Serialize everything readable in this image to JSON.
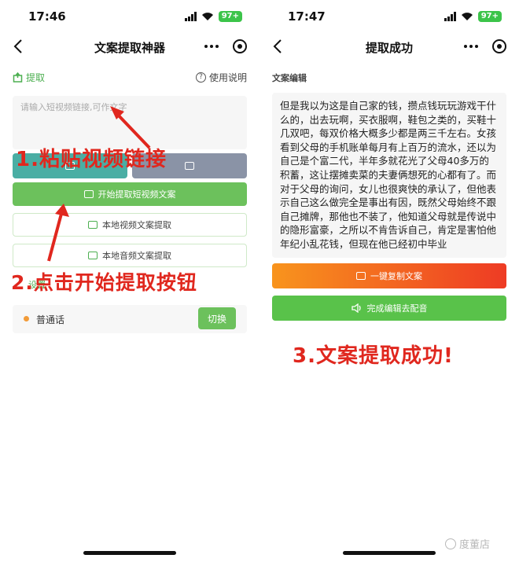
{
  "left": {
    "status": {
      "time": "17:46",
      "battery": "97+"
    },
    "nav": {
      "title": "文案提取神器"
    },
    "extract_tab": "提取",
    "help_label": "使用说明",
    "input_placeholder": "请输入短视频链接,可作文字",
    "start_button": "开始提取短视频文案",
    "local_video_button": "本地视频文案提取",
    "local_audio_button": "本地音频文案提取",
    "settings_label": "设置",
    "voice_name": "普通话",
    "switch_button": "切换"
  },
  "right": {
    "status": {
      "time": "17:47",
      "battery": "97+"
    },
    "nav": {
      "title": "提取成功"
    },
    "edit_label": "文案编辑",
    "extracted_text": "但是我以为这是自己家的钱，攒点钱玩玩游戏干什么的，出去玩啊，买衣服啊，鞋包之类的，买鞋十几双吧，每双价格大概多少都是两三千左右。女孩看到父母的手机账单每月有上百万的流水，还以为自己是个富二代，半年多就花光了父母40多万的积蓄，这让摆摊卖菜的夫妻俩想死的心都有了。而对于父母的询问，女儿也很爽快的承认了，但他表示自己这么做完全是事出有因，既然父母始终不跟自己摊牌，那他也不装了，他知道父母就是传说中的隐形富豪，之所以不肯告诉自己，肯定是害怕他年纪小乱花钱，但现在他已经初中毕业",
    "copy_button": "一键复制文案",
    "dub_button": "完成编辑去配音"
  },
  "annotations": {
    "step1": "1.粘贴视频链接",
    "step2": "2.点击开始提取按钮",
    "step3": "3.文案提取成功!"
  },
  "watermark": "度董店",
  "colors": {
    "accent_green": "#6cc15c",
    "annotation_red": "#e0271e",
    "copy_gradient_start": "#f8941d",
    "copy_gradient_end": "#ee3b24"
  },
  "icons": {
    "back": "chevron-left-icon",
    "more": "more-dots-icon",
    "target": "target-icon",
    "help": "question-circle-icon",
    "extract": "extract-icon",
    "video": "play-video-icon",
    "audio": "audio-text-icon",
    "copy": "copy-icon",
    "speaker": "speaker-icon"
  }
}
